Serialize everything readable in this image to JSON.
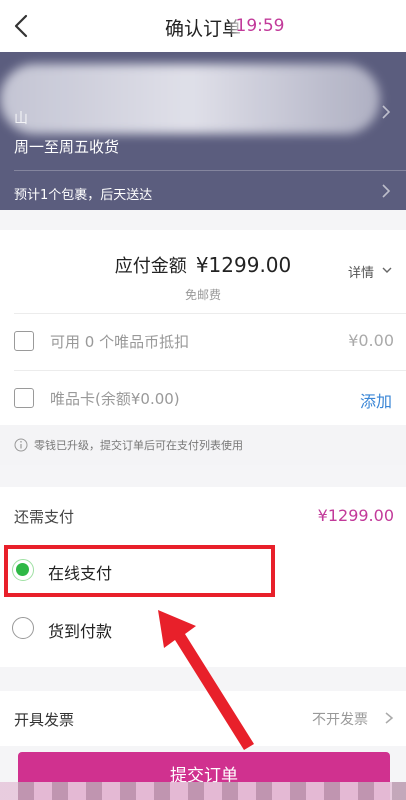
{
  "header": {
    "title": "确认订单",
    "time": "19:59"
  },
  "address": {
    "partial_text": "山",
    "receive_time": "周一至周五收货",
    "delivery_note": "预计1个包裹，后天送达"
  },
  "order": {
    "amount_label": "应付金额",
    "amount_value": "¥1299.00",
    "shipping": "免邮费",
    "detail_label": "详情"
  },
  "discounts": {
    "coin_label": "可用 0 个唯品币抵扣",
    "coin_value": "¥0.00",
    "card_label": "唯品卡(余额¥0.00)",
    "card_action": "添加"
  },
  "notice": {
    "text": "零钱已升级，提交订单后可在支付列表使用"
  },
  "payment": {
    "remaining_label": "还需支付",
    "remaining_value": "¥1299.00",
    "options": [
      {
        "label": "在线支付",
        "selected": true
      },
      {
        "label": "货到付款",
        "selected": false
      }
    ]
  },
  "invoice": {
    "label": "开具发票",
    "value": "不开发票"
  },
  "submit": {
    "label": "提交订单"
  },
  "colors": {
    "accent": "#d0318f",
    "price": "#c23a9a",
    "selected": "#2eb845",
    "address_bg": "#5b5d7e",
    "annotation": "#e8202a"
  }
}
